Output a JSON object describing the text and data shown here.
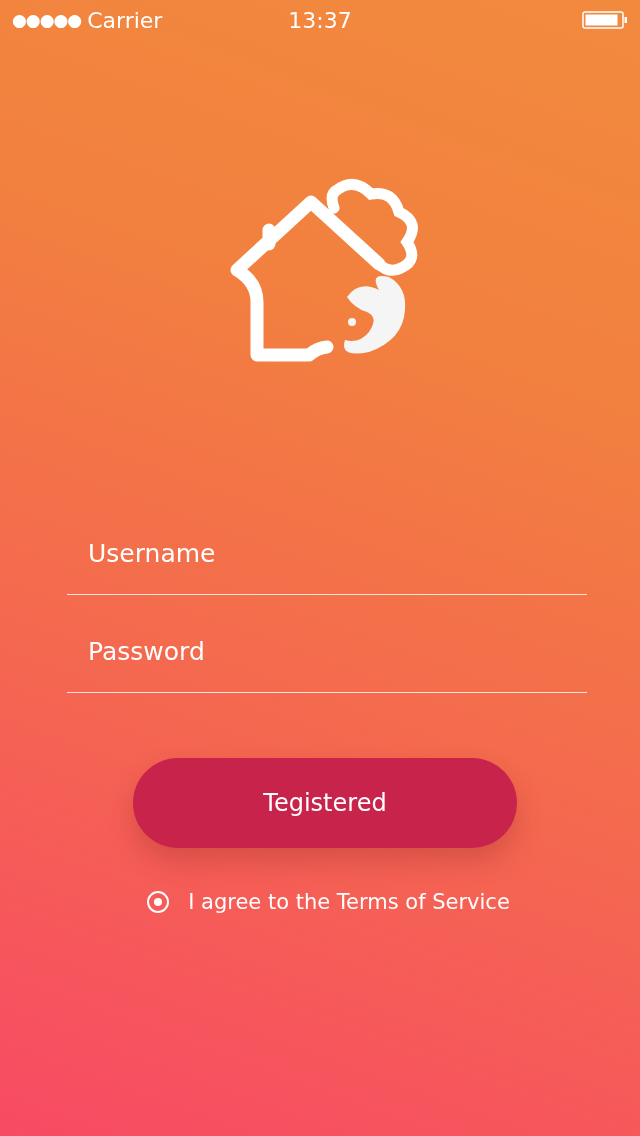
{
  "status_bar": {
    "carrier": "Carrier",
    "time": "13:37",
    "signal_dots": "●●●●●"
  },
  "form": {
    "fields": [
      {
        "placeholder": "Username"
      },
      {
        "placeholder": "Password"
      }
    ],
    "button": "Tegistered",
    "agree": {
      "label": "I agree to the Terms of Service",
      "selected": true
    }
  }
}
